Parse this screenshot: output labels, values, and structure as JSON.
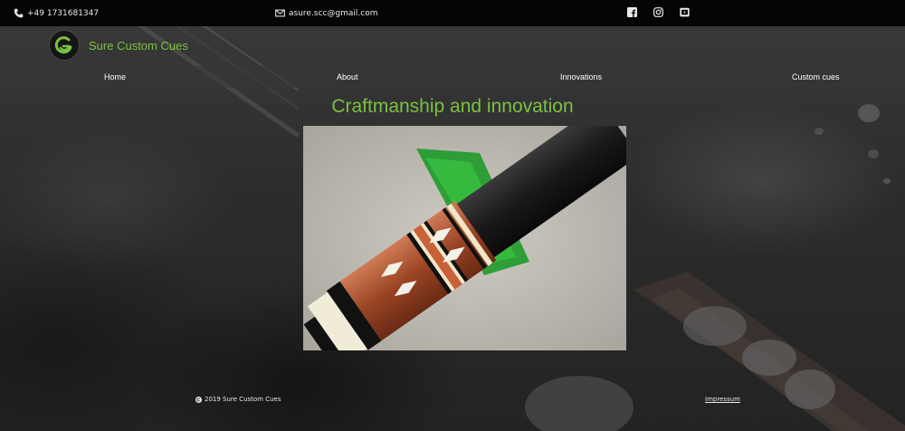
{
  "topbar": {
    "phone": "+49 1731681347",
    "email": "asure.scc@gmail.com",
    "socials": [
      {
        "icon": "facebook-icon"
      },
      {
        "icon": "instagram-icon"
      },
      {
        "icon": "youtube-icon"
      }
    ]
  },
  "brand": {
    "name": "Sure Custom Cues",
    "accent_color": "#7bc043"
  },
  "nav": {
    "items": [
      {
        "label": "Home"
      },
      {
        "label": "About"
      },
      {
        "label": "Innovations"
      },
      {
        "label": "Custom cues"
      }
    ]
  },
  "hero": {
    "title": "Craftmanship and innovation",
    "image": "custom-cue-photo"
  },
  "footer": {
    "copyright": "2019 Sure Custom Cues",
    "impressum": "Impressum"
  }
}
